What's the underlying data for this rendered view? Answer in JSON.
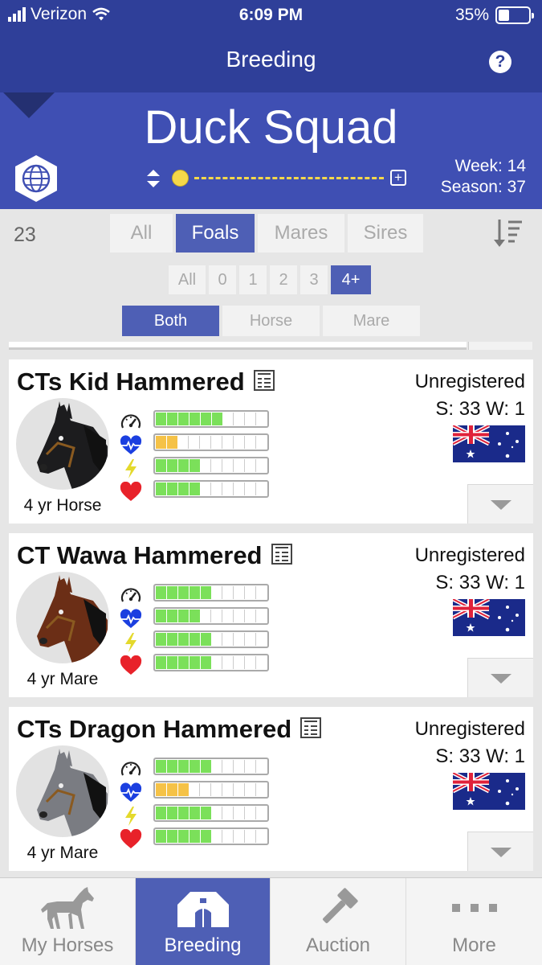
{
  "status_bar": {
    "carrier": "Verizon",
    "time": "6:09 PM",
    "battery": "35%"
  },
  "nav": {
    "title": "Breeding",
    "help_label": "?"
  },
  "team": {
    "name": "Duck Squad",
    "week": "Week: 14",
    "season": "Season: 37",
    "plus_label": "+"
  },
  "filters": {
    "count": "23",
    "category_tabs": [
      {
        "label": "All",
        "active": false
      },
      {
        "label": "Foals",
        "active": true
      },
      {
        "label": "Mares",
        "active": false
      },
      {
        "label": "Sires",
        "active": false
      }
    ],
    "age_tabs": [
      {
        "label": "All",
        "active": false
      },
      {
        "label": "0",
        "active": false
      },
      {
        "label": "1",
        "active": false
      },
      {
        "label": "2",
        "active": false
      },
      {
        "label": "3",
        "active": false
      },
      {
        "label": "4+",
        "active": true
      }
    ],
    "gender_tabs": [
      {
        "label": "Both",
        "active": true
      },
      {
        "label": "Horse",
        "active": false
      },
      {
        "label": "Mare",
        "active": false
      }
    ]
  },
  "horses": [
    {
      "name": "CTs Kid Hammered",
      "age": "4 yr Horse",
      "registration": "Unregistered",
      "season_week": "S: 33 W: 1",
      "coat": "#1c1c1e",
      "stats": [
        {
          "icon": "speedometer-icon",
          "segments": 6,
          "color": "#7be05a"
        },
        {
          "icon": "heartbeat-icon",
          "segments": 2,
          "color": "#f5c247"
        },
        {
          "icon": "lightning-icon",
          "segments": 4,
          "color": "#7be05a"
        },
        {
          "icon": "heart-icon",
          "segments": 4,
          "color": "#7be05a"
        }
      ]
    },
    {
      "name": "CT Wawa Hammered",
      "age": "4 yr Mare",
      "registration": "Unregistered",
      "season_week": "S: 33 W: 1",
      "coat": "#6b2e16",
      "stats": [
        {
          "icon": "speedometer-icon",
          "segments": 5,
          "color": "#7be05a"
        },
        {
          "icon": "heartbeat-icon",
          "segments": 4,
          "color": "#7be05a"
        },
        {
          "icon": "lightning-icon",
          "segments": 5,
          "color": "#7be05a"
        },
        {
          "icon": "heart-icon",
          "segments": 5,
          "color": "#7be05a"
        }
      ]
    },
    {
      "name": "CTs Dragon Hammered",
      "age": "4 yr Mare",
      "registration": "Unregistered",
      "season_week": "S: 33 W: 1",
      "coat": "#7a7c82",
      "stats": [
        {
          "icon": "speedometer-icon",
          "segments": 5,
          "color": "#7be05a"
        },
        {
          "icon": "heartbeat-icon",
          "segments": 3,
          "color": "#f5c247"
        },
        {
          "icon": "lightning-icon",
          "segments": 5,
          "color": "#7be05a"
        },
        {
          "icon": "heart-icon",
          "segments": 5,
          "color": "#7be05a"
        }
      ]
    }
  ],
  "tabbar": [
    {
      "label": "My Horses",
      "icon": "horse-icon",
      "active": false
    },
    {
      "label": "Breeding",
      "icon": "barn-icon",
      "active": true
    },
    {
      "label": "Auction",
      "icon": "gavel-icon",
      "active": false
    },
    {
      "label": "More",
      "icon": "more-dots-icon",
      "active": false
    }
  ],
  "colors": {
    "header": "#2f3f99",
    "team_header": "#3f4fb3",
    "accent": "#4e5fb5",
    "bar_green": "#7be05a",
    "bar_yellow": "#f5c247"
  }
}
